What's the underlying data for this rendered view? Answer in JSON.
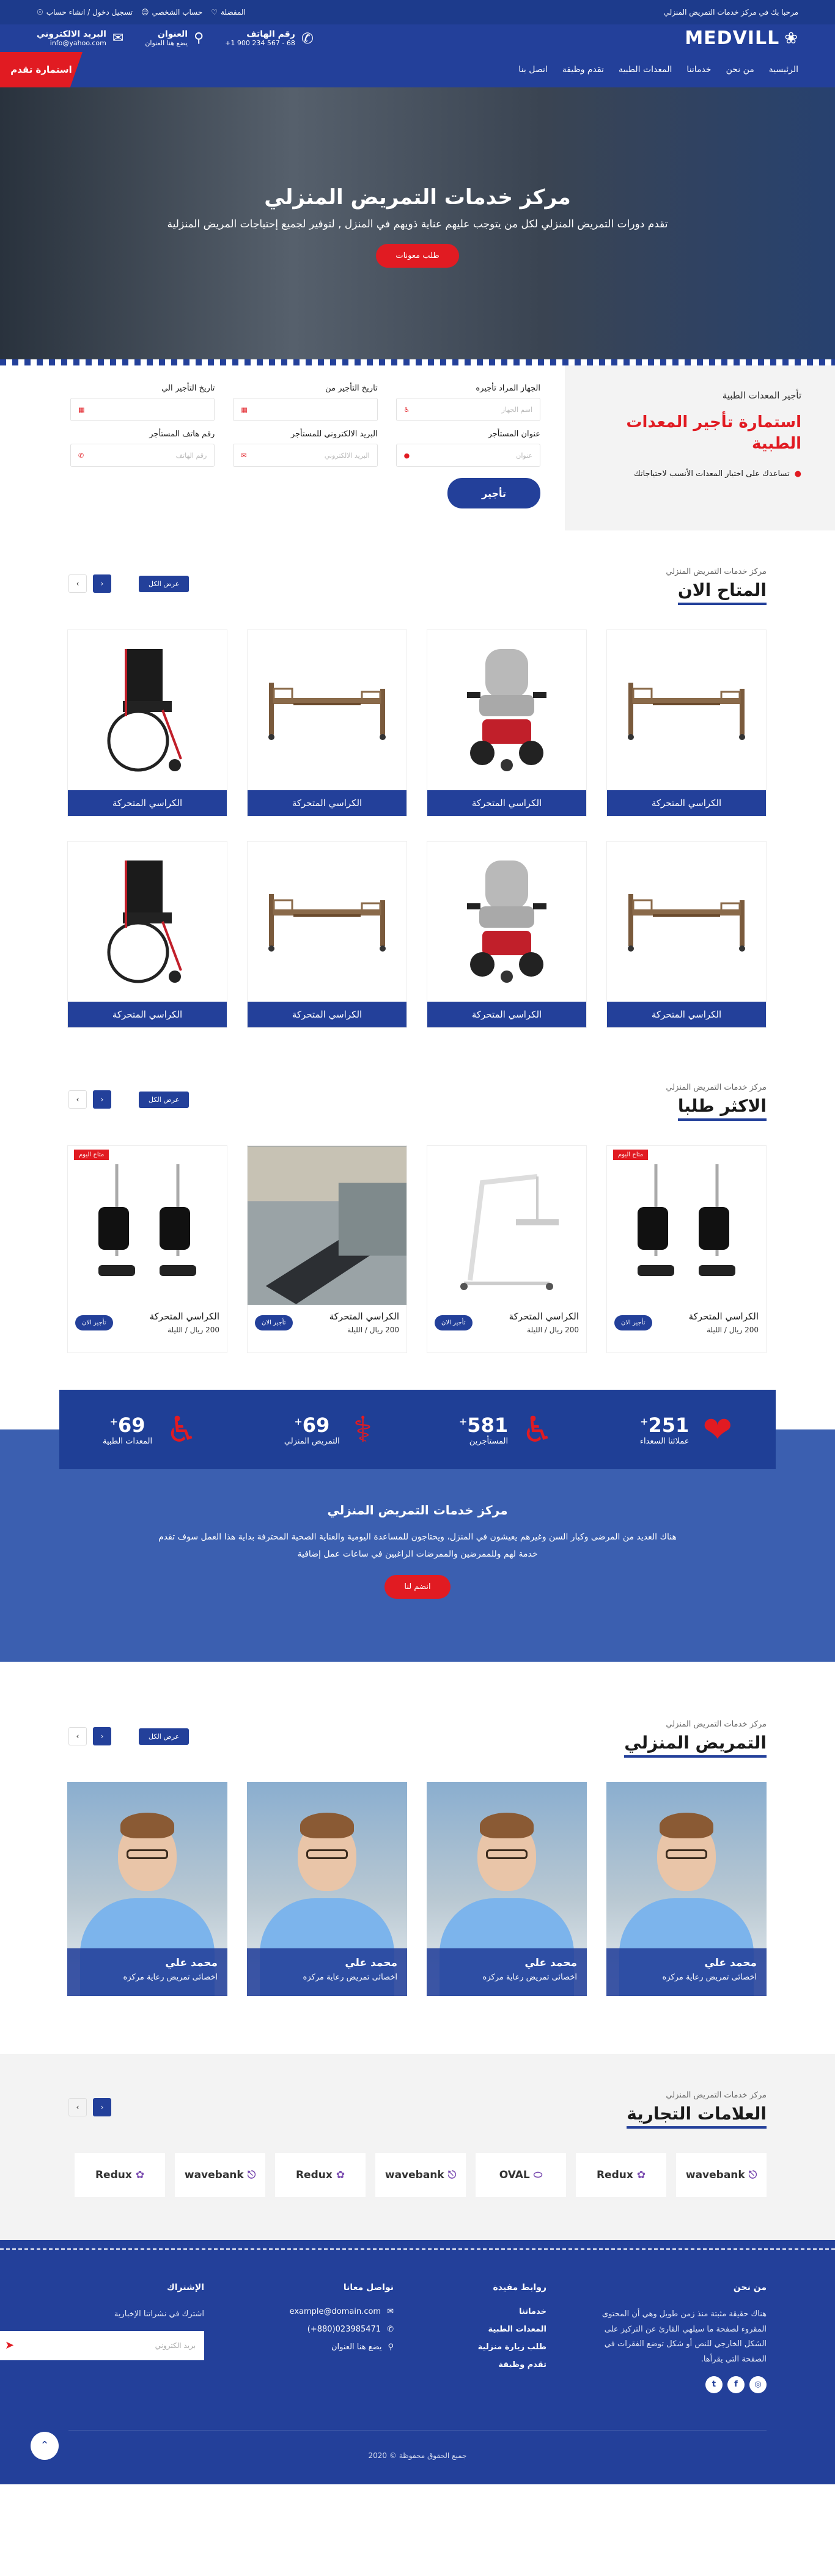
{
  "topbar": {
    "welcome": "مرحبا بك في مركز خدمات التمريض المنزلي",
    "favorite": "المفضلة",
    "account": "حساب الشخصي",
    "login": "تسجيل دخول / انشاء حساب"
  },
  "header": {
    "logo": "MEDVILL",
    "phone": {
      "title": "رقم الهاتف",
      "value": "+1 900 234 567 - 68"
    },
    "address": {
      "title": "العنوان",
      "value": "يضع هنا العنوان"
    },
    "email": {
      "title": "البريد الالكتروني",
      "value": "info@yahoo.com"
    }
  },
  "nav": {
    "items": [
      "الرئيسية",
      "من نحن",
      "خدماتنا",
      "المعدات الطبية",
      "تقدم وظيفة",
      "اتصل بنا"
    ],
    "apply": "استمارة تقدم"
  },
  "hero": {
    "title": "مركز خدمات التمريض المنزلي",
    "subtitle": "تقدم دورات التمريض المنزلي لكل من يتوجب عليهم عناية ذويهم في المنزل , لتوفير لجميع إحتياجات المريض المنزلية",
    "button": "طلب معونات"
  },
  "booking": {
    "small": "تأجير المعدات الطبية",
    "title": "استمارة تأجير المعدات الطبية",
    "bullet": "تساعدك على اختيار المعدات الأنسب لاحتياجاتك",
    "fields": [
      {
        "label": "الجهاز المراد تأجيره",
        "placeholder": "اسم الجهاز",
        "icon": "♿"
      },
      {
        "label": "تاريخ التأجير من",
        "placeholder": "",
        "icon": "▦"
      },
      {
        "label": "تاريخ التأجير الي",
        "placeholder": "",
        "icon": "▦"
      },
      {
        "label": "عنوان المستأجر",
        "placeholder": "عنوان",
        "icon": "●"
      },
      {
        "label": "البريد الالكتروني للمستأجر",
        "placeholder": "البريد الالكتروني",
        "icon": "✉"
      },
      {
        "label": "رقم هاتف المستأجر",
        "placeholder": "رقم الهاتف",
        "icon": "✆"
      }
    ],
    "submit": "تأجير"
  },
  "available": {
    "sub": "مركز خدمات التمريض المنزلي",
    "title": "المتاح الان",
    "show_all": "عرض الكل",
    "products": [
      {
        "name": "الكراسي المتحركة",
        "img": "bed"
      },
      {
        "name": "الكراسي المتحركة",
        "img": "power-chair"
      },
      {
        "name": "الكراسي المتحركة",
        "img": "bed"
      },
      {
        "name": "الكراسي المتحركة",
        "img": "wheelchair"
      },
      {
        "name": "الكراسي المتحركة",
        "img": "bed"
      },
      {
        "name": "الكراسي المتحركة",
        "img": "power-chair"
      },
      {
        "name": "الكراسي المتحركة",
        "img": "bed"
      },
      {
        "name": "الكراسي المتحركة",
        "img": "wheelchair"
      }
    ]
  },
  "popular": {
    "sub": "مركز خدمات التمريض المنزلي",
    "title": "الاكثر طلبا",
    "show_all": "عرض الكل",
    "tag": "متاح اليوم",
    "rent": "تأجير الان",
    "products": [
      {
        "name": "الكراسي المتحركة",
        "price": "200 ريال / الليلة",
        "img": "leg-rests",
        "tag": true
      },
      {
        "name": "الكراسي المتحركة",
        "price": "200 ريال / الليلة",
        "img": "lift",
        "tag": false
      },
      {
        "name": "الكراسي المتحركة",
        "price": "200 ريال / الليلة",
        "img": "ramp",
        "tag": false
      },
      {
        "name": "الكراسي المتحركة",
        "price": "200 ريال / الليلة",
        "img": "leg-rests",
        "tag": true
      }
    ]
  },
  "stats": [
    {
      "value": "251",
      "label": "عملائنا السعداء",
      "icon": "heart-icon"
    },
    {
      "value": "581",
      "label": "المستأجرين",
      "icon": "accessible-icon"
    },
    {
      "value": "69",
      "label": "التمريض المنزلي",
      "icon": "stethoscope-icon"
    },
    {
      "value": "69",
      "label": "المعدات الطبية",
      "icon": "wheelchair-icon"
    }
  ],
  "band": {
    "title": "مركز خدمات التمريض المنزلي",
    "text": "هناك العديد من المرضى وكبار السن وغيرهم يعيشون في المنزل، ويحتاجون للمساعدة اليومية والعناية الصحية المحترفة بداية هذا العمل سوف تقدم خدمة لهم وللممرضين والممرضات الراغبين في ساعات عمل إضافية",
    "button": "انضم لنا"
  },
  "nursing": {
    "sub": "مركز خدمات التمريض المنزلي",
    "title": "التمريض المنزلي",
    "show_all": "عرض الكل",
    "people": [
      {
        "name": "محمد علي",
        "role": "اخصائى تمريض رعاية مركزه"
      },
      {
        "name": "محمد علي",
        "role": "اخصائى تمريض رعاية مركزه"
      },
      {
        "name": "محمد علي",
        "role": "اخصائى تمريض رعاية مركزه"
      },
      {
        "name": "محمد علي",
        "role": "اخصائى تمريض رعاية مركزه"
      }
    ]
  },
  "brands": {
    "sub": "مركز خدمات التمريض المنزلي",
    "title": "العلامات التجارية",
    "items": [
      "wavebank",
      "Redux",
      "OVAL",
      "wavebank",
      "Redux",
      "wavebank",
      "Redux"
    ]
  },
  "footer": {
    "about": {
      "title": "من نحن",
      "text": "هناك حقيقة مثبتة منذ زمن طويل وهي أن المحتوى المقروء لصفحة ما سيلهي القارئ عن التركيز على الشكل الخارجي للنص أو شكل توضع الفقرات في الصفحة التي يقرأها."
    },
    "links": {
      "title": "روابط مفيدة",
      "items": [
        "خدماتنا",
        "المعدات الطبية",
        "طلب زيارة منزلية",
        "تقدم وظيفة"
      ]
    },
    "contact": {
      "title": "تواصل معانا",
      "email": "example@domain.com",
      "phone": "(+880)023985471",
      "address": "يضع هنا العنوان"
    },
    "subscribe": {
      "title": "الإشتراك",
      "text": "اشترك في نشراتنا الإخبارية",
      "placeholder": "بريد الكتروني"
    },
    "copyright": "جميع الحقوق محفوظة © 2020"
  }
}
